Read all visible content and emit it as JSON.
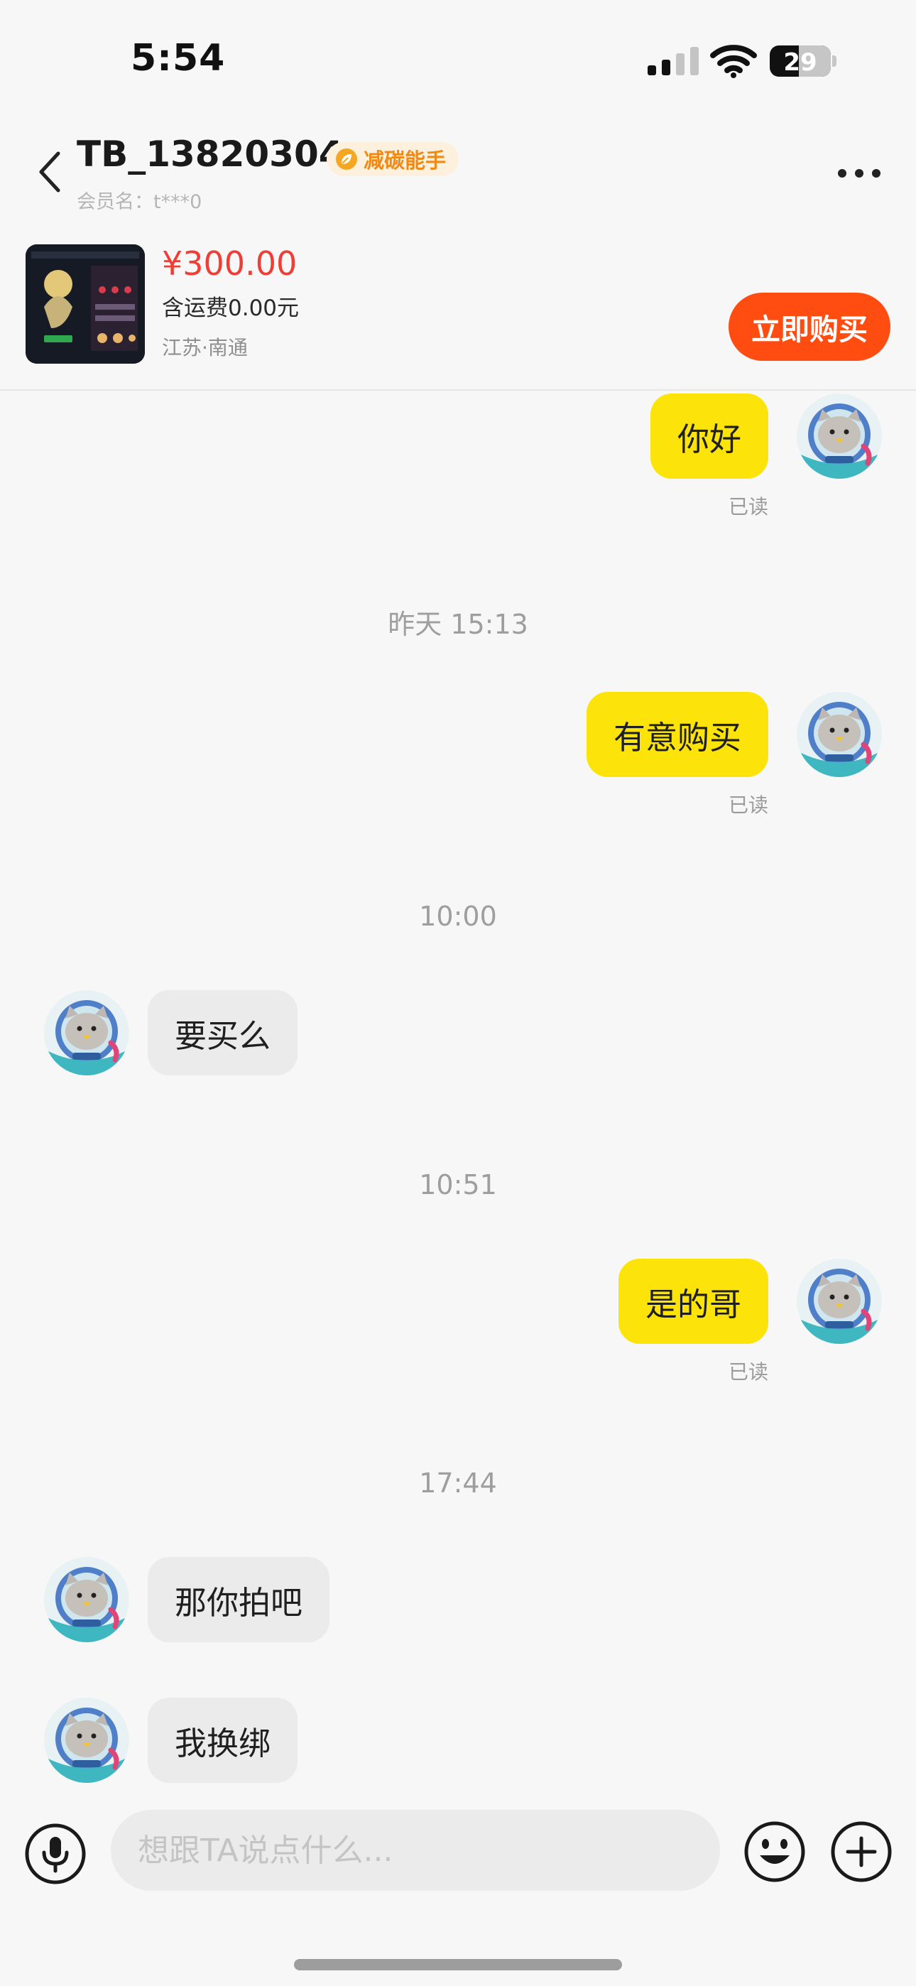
{
  "status_bar": {
    "time": "5:54",
    "battery": "29"
  },
  "header": {
    "seller_name": "TB_13820304",
    "eco_badge": "减碳能手",
    "member_name": "会员名：t***0",
    "back_icon": "chevron-left-icon",
    "more_icon": "ellipsis-icon"
  },
  "product": {
    "price": "¥300.00",
    "shipping": "含运费0.00元",
    "location": "江苏·南通",
    "buy_label": "立即购买"
  },
  "chat": {
    "read_label": "已读",
    "messages": [
      {
        "from": "me",
        "text": "你好"
      },
      {
        "time": "昨天 15:13"
      },
      {
        "from": "me",
        "text": "有意购买"
      },
      {
        "time": "10:00"
      },
      {
        "from": "them",
        "text": "要买么"
      },
      {
        "time": "10:51"
      },
      {
        "from": "me",
        "text": "是的哥"
      },
      {
        "time": "17:44"
      },
      {
        "from": "them",
        "text": "那你拍吧"
      },
      {
        "from": "them",
        "text": "我换绑"
      }
    ]
  },
  "input": {
    "placeholder": "想跟TA说点什么..."
  },
  "colors": {
    "my_bubble": "#fce30a",
    "their_bubble": "#ebebeb",
    "price": "#ee3e36",
    "buy_button": "#ff4d12",
    "eco_badge_text": "#f08a16"
  }
}
